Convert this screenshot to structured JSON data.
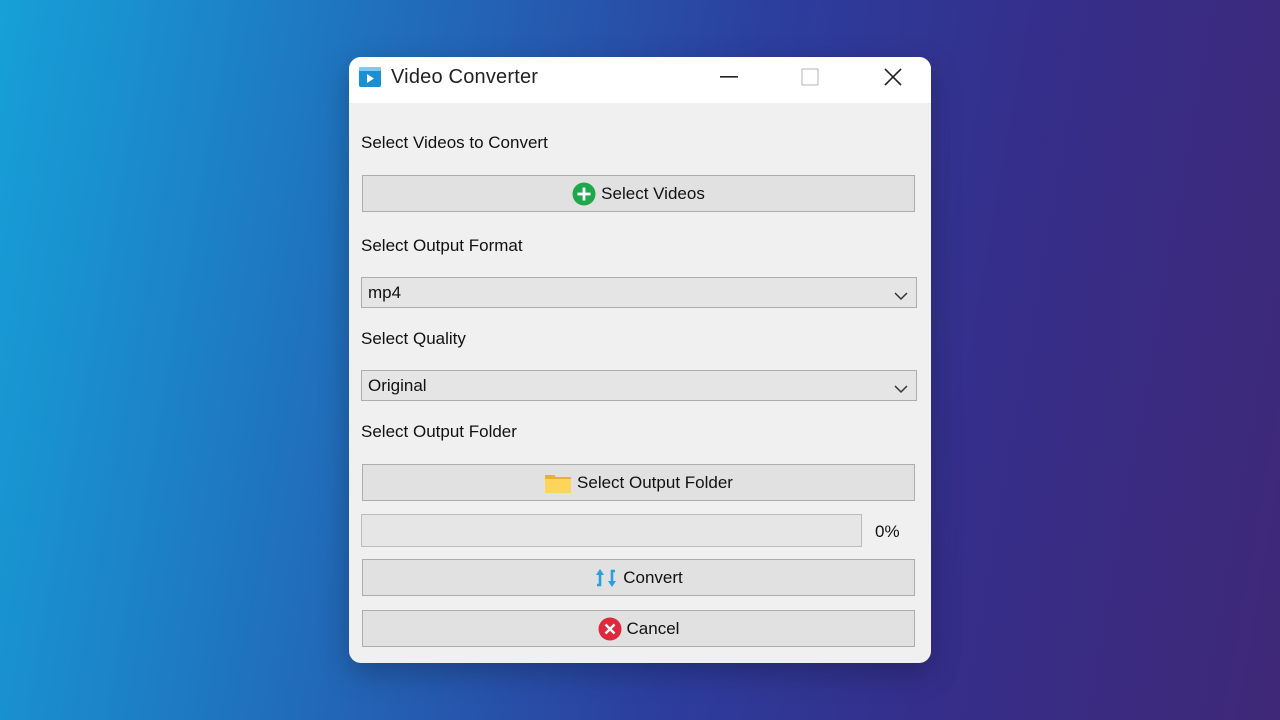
{
  "window": {
    "title": "Video Converter"
  },
  "sections": {
    "videos_label": "Select Videos to Convert",
    "format_label": "Select Output Format",
    "quality_label": "Select Quality",
    "folder_label": "Select Output Folder"
  },
  "buttons": {
    "select_videos": "Select Videos",
    "select_folder": "Select Output Folder",
    "convert": "Convert",
    "cancel": "Cancel"
  },
  "selects": {
    "format_value": "mp4",
    "quality_value": "Original"
  },
  "progress": {
    "value": 0,
    "text": "0%"
  },
  "colors": {
    "add_icon": "#1ea84b",
    "cancel_icon": "#e0283c",
    "convert_icon": "#2a9fe0",
    "folder_icon": "#f7c948",
    "app_icon": "#1a8fd6"
  },
  "icons": {
    "app": "video-player-icon",
    "add": "plus-circle-icon",
    "folder": "folder-icon",
    "convert": "refresh-icon",
    "cancel": "x-circle-icon"
  }
}
